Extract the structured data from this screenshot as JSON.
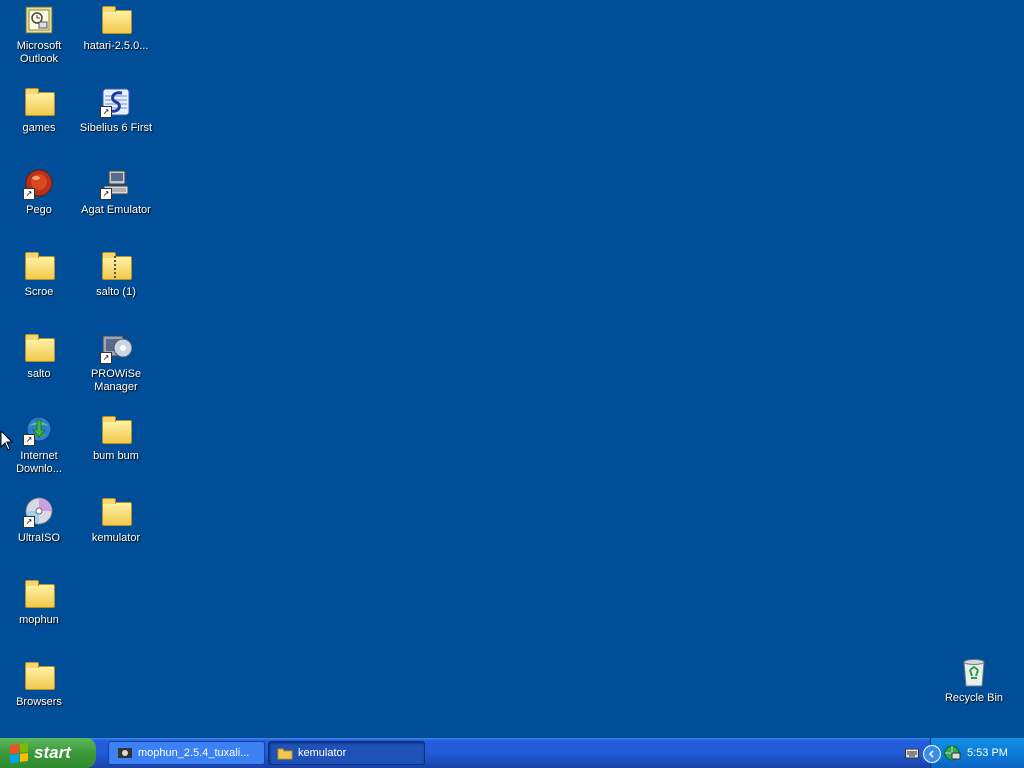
{
  "desktop": {
    "icons": [
      {
        "label": "Microsoft Outlook",
        "type": "app"
      },
      {
        "label": "hatari-2.5.0...",
        "type": "folder"
      },
      {
        "label": "games",
        "type": "folder"
      },
      {
        "label": "Sibelius 6 First",
        "type": "shortcut"
      },
      {
        "label": "Pego",
        "type": "shortcut"
      },
      {
        "label": "Agat Emulator",
        "type": "shortcut"
      },
      {
        "label": "Scroe",
        "type": "folder"
      },
      {
        "label": "salto (1)",
        "type": "zip-folder"
      },
      {
        "label": "salto",
        "type": "folder"
      },
      {
        "label": "PROWiSe Manager",
        "type": "shortcut"
      },
      {
        "label": "Internet Downlo...",
        "type": "shortcut"
      },
      {
        "label": "bum bum",
        "type": "folder"
      },
      {
        "label": "UltraISO",
        "type": "shortcut"
      },
      {
        "label": "kemulator",
        "type": "folder"
      },
      {
        "label": "mophun",
        "type": "folder"
      },
      {
        "label": "Browsers",
        "type": "folder"
      },
      {
        "label": "Recycle Bin",
        "type": "system"
      }
    ]
  },
  "taskbar": {
    "start_label": "start",
    "tasks": [
      {
        "label": "mophun_2.5.4_tuxali...",
        "icon": "app-icon",
        "active": false
      },
      {
        "label": "kemulator",
        "icon": "folder-icon",
        "active": true
      }
    ],
    "tray": {
      "clock": "5:53 PM",
      "icons": [
        "keyboard-icon",
        "chevron-left-icon",
        "network-icon"
      ]
    }
  },
  "colors": {
    "desktop_bg": "#004e98",
    "taskbar_blue": "#245edb",
    "start_green": "#3d9a3d",
    "tray_blue": "#0c7bd8"
  }
}
